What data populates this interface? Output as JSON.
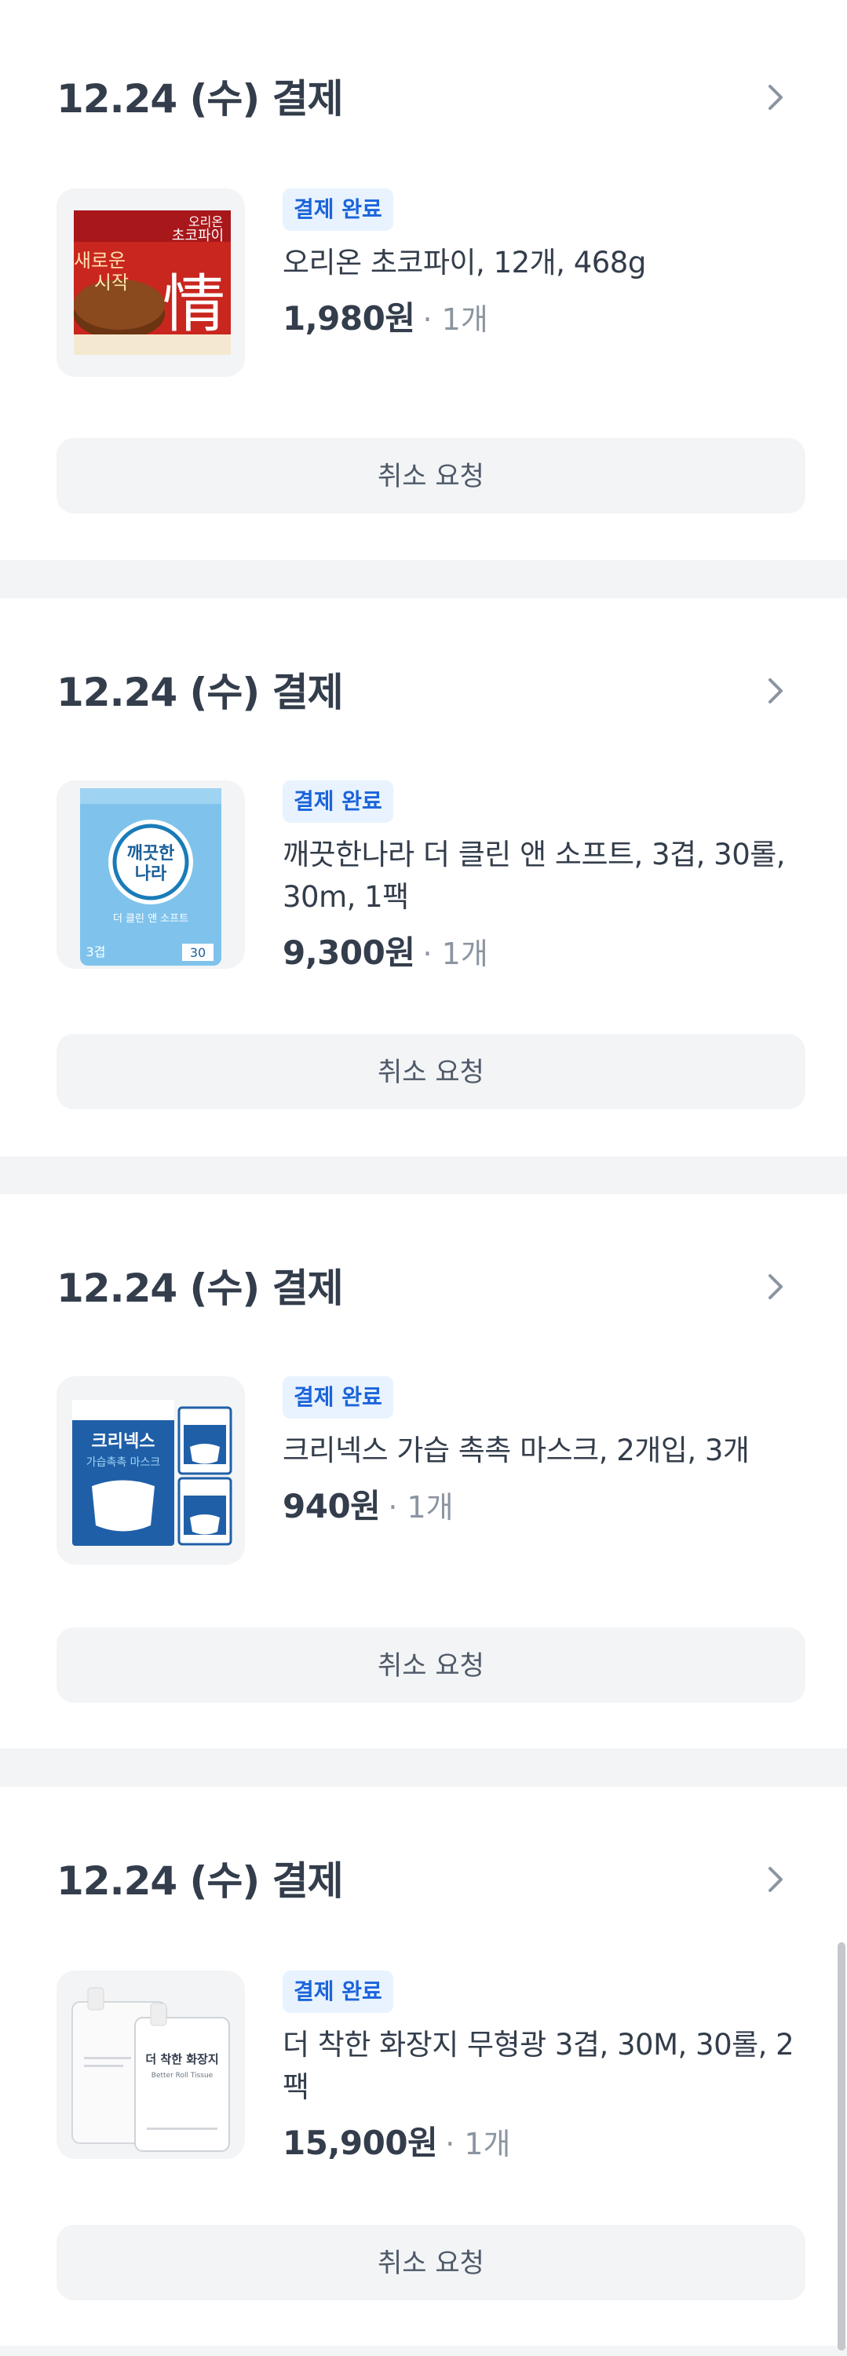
{
  "orders": [
    {
      "date": "12.24 (수) 결제",
      "status": "결제 완료",
      "name": "오리온 초코파이, 12개, 468g",
      "price": "1,980원",
      "qty": "· 1개",
      "cancel": "취소 요청",
      "image_texts": [
        "오리온",
        "초코파이",
        "새로운",
        "시작",
        "情"
      ]
    },
    {
      "date": "12.24 (수) 결제",
      "status": "결제 완료",
      "name": "깨끗한나라 더 클린 앤 소프트, 3겹, 30롤, 30m, 1팩",
      "price": "9,300원",
      "qty": "· 1개",
      "cancel": "취소 요청",
      "image_texts": [
        "깨끗한",
        "나라",
        "더 클린 앤 소프트",
        "3겹",
        "30"
      ]
    },
    {
      "date": "12.24 (수) 결제",
      "status": "결제 완료",
      "name": "크리넥스 가습 촉촉 마스크, 2개입, 3개",
      "price": "940원",
      "qty": "· 1개",
      "cancel": "취소 요청",
      "image_texts": [
        "크리넥스",
        "가습촉촉 마스크"
      ]
    },
    {
      "date": "12.24 (수) 결제",
      "status": "결제 완료",
      "name": "더 착한 화장지 무형광 3겹, 30M, 30롤, 2팩",
      "price": "15,900원",
      "qty": "· 1개",
      "cancel": "취소 요청",
      "image_texts": [
        "더 착한 화장지",
        "Better Roll Tissue"
      ]
    }
  ],
  "colors": {
    "background": "#f2f4f6",
    "card": "#ffffff",
    "badge_bg": "#e8f3ff",
    "badge_text": "#1b64da",
    "text_primary": "#333d4b",
    "text_secondary": "#8b95a1"
  },
  "icons": {
    "chevron": "chevron-right-icon"
  }
}
